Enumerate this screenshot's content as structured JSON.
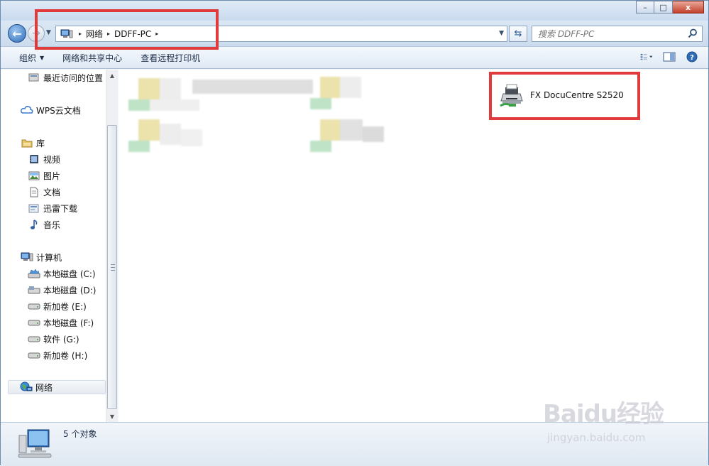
{
  "window": {
    "caption_buttons": {
      "minimize": "–",
      "maximize": "□",
      "close": "x"
    }
  },
  "address": {
    "crumbs": [
      "网络",
      "DDFF-PC"
    ],
    "separator": "▸",
    "search_placeholder": "搜索 DDFF-PC"
  },
  "toolbar": {
    "organize": "组织",
    "network_sharing": "网络和共享中心",
    "view_remote_printers": "查看远程打印机"
  },
  "sidebar": {
    "items": [
      {
        "label": "最近访问的位置",
        "icon": "recent-places-icon"
      },
      {
        "label": "WPS云文档",
        "icon": "cloud-icon"
      },
      {
        "label": "库",
        "icon": "library-icon"
      },
      {
        "label": "视频",
        "icon": "video-icon"
      },
      {
        "label": "图片",
        "icon": "pictures-icon"
      },
      {
        "label": "文档",
        "icon": "documents-icon"
      },
      {
        "label": "迅雷下载",
        "icon": "download-icon"
      },
      {
        "label": "音乐",
        "icon": "music-icon"
      },
      {
        "label": "计算机",
        "icon": "computer-icon"
      },
      {
        "label": "本地磁盘 (C:)",
        "icon": "drive-c-icon"
      },
      {
        "label": "本地磁盘 (D:)",
        "icon": "drive-icon"
      },
      {
        "label": "新加卷 (E:)",
        "icon": "drive-icon"
      },
      {
        "label": "本地磁盘 (F:)",
        "icon": "drive-icon"
      },
      {
        "label": "软件 (G:)",
        "icon": "drive-icon"
      },
      {
        "label": "新加卷 (H:)",
        "icon": "drive-icon"
      },
      {
        "label": "网络",
        "icon": "network-icon"
      }
    ]
  },
  "content": {
    "printer_label": "FX DocuCentre S2520"
  },
  "status": {
    "object_count": "5 个对象"
  },
  "watermark": {
    "logo": "Baidu经验",
    "url": "jingyan.baidu.com"
  },
  "colors": {
    "highlight": "#e03a3a",
    "accent": "#2f6cb6"
  }
}
